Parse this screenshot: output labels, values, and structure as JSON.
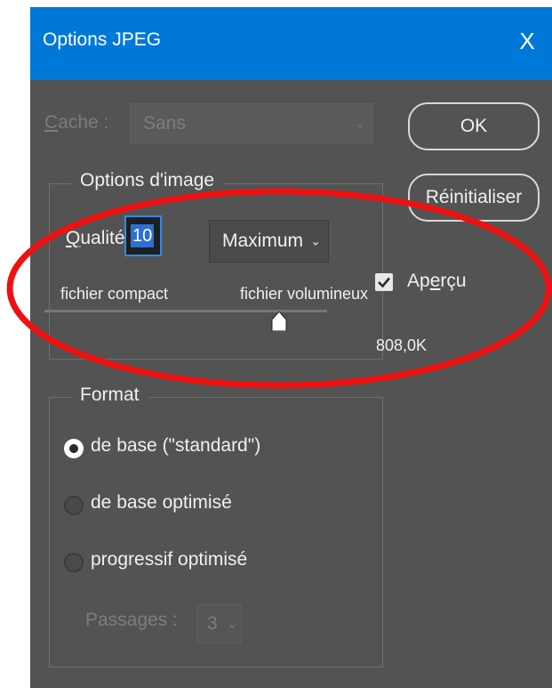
{
  "window": {
    "title": "Options JPEG",
    "close_glyph": "X"
  },
  "matte": {
    "label": "Cache :",
    "value": "Sans"
  },
  "image_options": {
    "group_label": "Options d'image",
    "quality_label": "Qualité :",
    "quality_value": "10",
    "quality_preset": "Maximum",
    "slider_left_label": "fichier compact",
    "slider_right_label": "fichier volumineux",
    "slider_level_fraction": 0.85
  },
  "format": {
    "group_label": "Format",
    "options": [
      {
        "label": "de base  (\"standard\")",
        "selected": true
      },
      {
        "label": "de base optimisé",
        "selected": false
      },
      {
        "label": "progressif optimisé",
        "selected": false
      }
    ],
    "passes_label": "Passages :",
    "passes_value": "3"
  },
  "buttons": {
    "ok": "OK",
    "reset": "Réinitialiser"
  },
  "preview": {
    "label": "Aperçu",
    "checked": true,
    "file_size": "808,0K"
  },
  "colors": {
    "titlebar": "#0078d7",
    "dialog_bg": "#535353",
    "highlight_ellipse": "#ee1111",
    "selection": "#2d6fd6"
  }
}
